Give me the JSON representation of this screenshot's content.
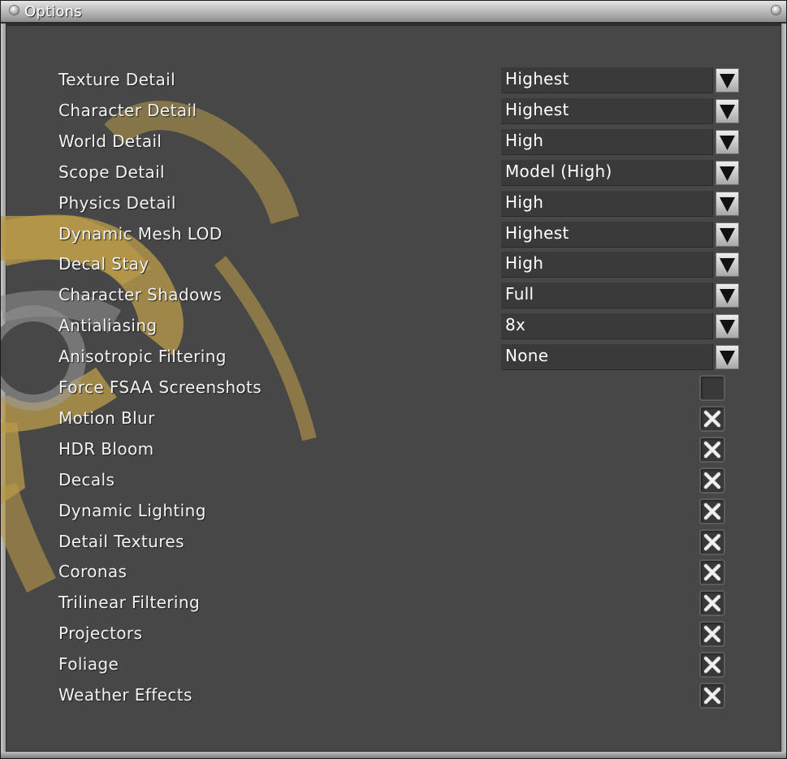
{
  "window": {
    "title": "Options"
  },
  "colors": {
    "panel_bg": "#474747",
    "combo_bg": "#3a3a3a",
    "label_text": "#f2f2f2",
    "emblem": "#b89a4a"
  },
  "combos": [
    {
      "label": "Texture Detail",
      "value": "Highest"
    },
    {
      "label": "Character Detail",
      "value": "Highest"
    },
    {
      "label": "World Detail",
      "value": "High"
    },
    {
      "label": "Scope Detail",
      "value": "Model (High)"
    },
    {
      "label": "Physics Detail",
      "value": "High"
    },
    {
      "label": "Dynamic Mesh LOD",
      "value": "Highest"
    },
    {
      "label": "Decal Stay",
      "value": "High"
    },
    {
      "label": "Character Shadows",
      "value": "Full"
    },
    {
      "label": "Antialiasing",
      "value": "8x"
    },
    {
      "label": "Anisotropic Filtering",
      "value": "None"
    }
  ],
  "checkboxes": [
    {
      "label": "Force FSAA Screenshots",
      "checked": false
    },
    {
      "label": "Motion Blur",
      "checked": true
    },
    {
      "label": "HDR Bloom",
      "checked": true
    },
    {
      "label": "Decals",
      "checked": true
    },
    {
      "label": "Dynamic Lighting",
      "checked": true
    },
    {
      "label": "Detail Textures",
      "checked": true
    },
    {
      "label": "Coronas",
      "checked": true
    },
    {
      "label": "Trilinear Filtering",
      "checked": true
    },
    {
      "label": "Projectors",
      "checked": true
    },
    {
      "label": "Foliage",
      "checked": true
    },
    {
      "label": "Weather Effects",
      "checked": true
    }
  ],
  "icons": {
    "combo_arrow": "triangle-down-icon",
    "check_mark": "x-mark-icon",
    "title_knob": "window-knob-icon",
    "emblem": "biohazard-emblem"
  }
}
